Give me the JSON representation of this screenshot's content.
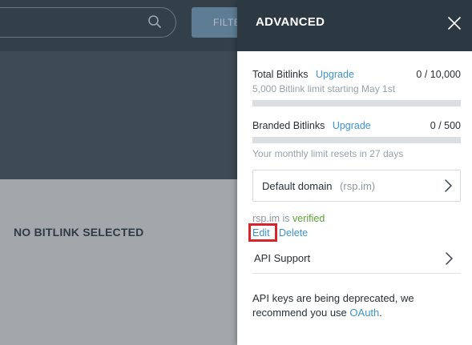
{
  "toolbar": {
    "filter_label": "FILTE"
  },
  "main": {
    "empty_state": "NO BITLINK SELECTED"
  },
  "panel": {
    "title": "ADVANCED",
    "total_bitlinks": {
      "label": "Total Bitlinks",
      "upgrade": "Upgrade",
      "count": "0 / 10,000",
      "note": "5,000 Bitlink limit starting May 1st",
      "usage_fraction": 0
    },
    "branded_bitlinks": {
      "label": "Branded Bitlinks",
      "upgrade": "Upgrade",
      "count": "0 / 500",
      "note": "Your monthly limit resets in 27 days",
      "usage_fraction": 0
    },
    "default_domain": {
      "label": "Default domain",
      "value": "(rsp.im)"
    },
    "domain_status": {
      "domain": "rsp.im is",
      "status": "verified",
      "edit": "Edit",
      "delete": "Delete"
    },
    "api_support": {
      "label": "API Support"
    },
    "deprecation": {
      "text": "API keys are being deprecated, we recommend you use",
      "link": "OAuth",
      "suffix": "."
    }
  },
  "colors": {
    "accent": "#3e93c9",
    "verified": "#5ba535",
    "highlight": "#d6262b",
    "header": "#2d3942"
  },
  "icons": {
    "search": "search-icon",
    "close": "close-icon",
    "chevron": "chevron-right-icon"
  }
}
